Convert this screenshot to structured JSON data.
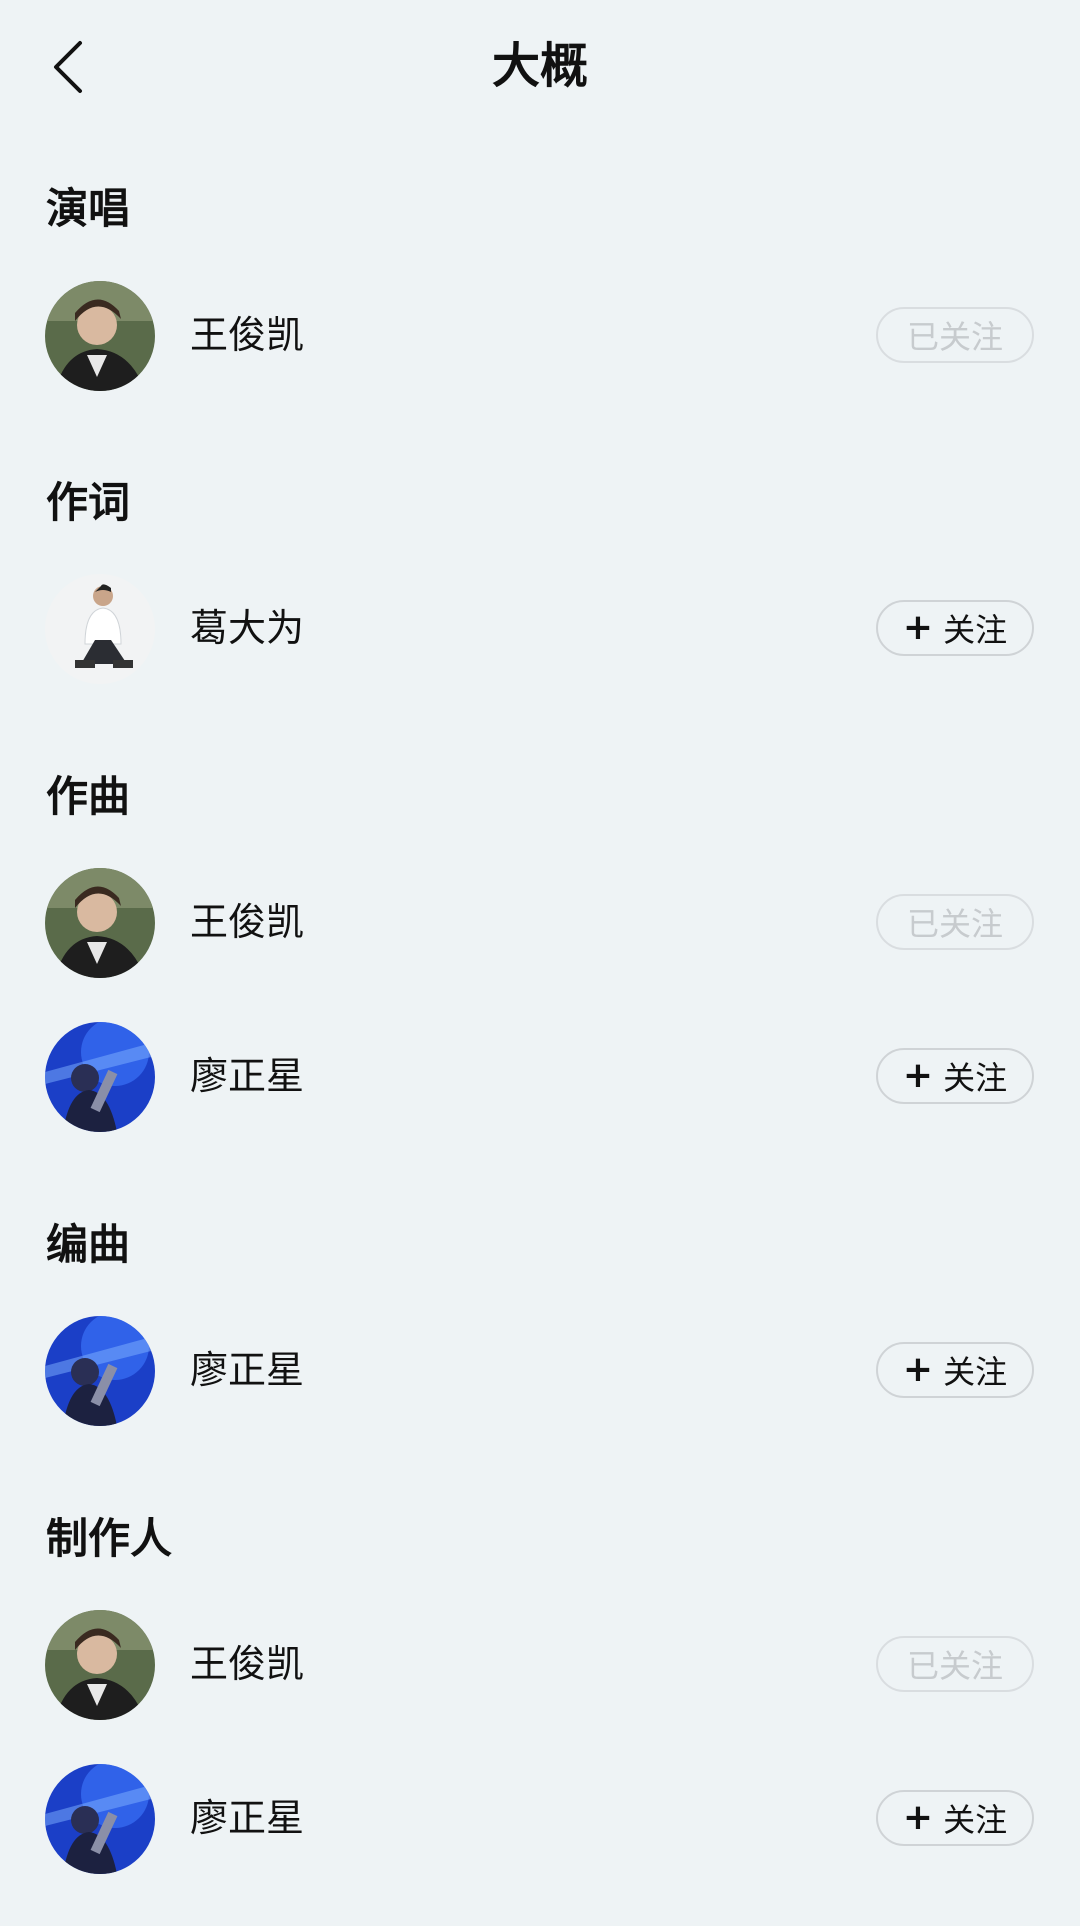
{
  "header": {
    "title": "大概"
  },
  "sections": [
    {
      "title": "演唱",
      "people": [
        {
          "name": "王俊凯",
          "follow_label": "已关注",
          "followed": true
        }
      ]
    },
    {
      "title": "作词",
      "people": [
        {
          "name": "葛大为",
          "follow_label": "关注",
          "followed": false
        }
      ]
    },
    {
      "title": "作曲",
      "people": [
        {
          "name": "王俊凯",
          "follow_label": "已关注",
          "followed": true
        },
        {
          "name": "廖正星",
          "follow_label": "关注",
          "followed": false
        }
      ]
    },
    {
      "title": "编曲",
      "people": [
        {
          "name": "廖正星",
          "follow_label": "关注",
          "followed": false
        }
      ]
    },
    {
      "title": "制作人",
      "people": [
        {
          "name": "王俊凯",
          "follow_label": "已关注",
          "followed": true
        },
        {
          "name": "廖正星",
          "follow_label": "关注",
          "followed": false
        }
      ]
    }
  ],
  "colors": {
    "background": "#eef3f5",
    "followed_text": "#c7cbce",
    "button_border": "#cfd3d6"
  }
}
